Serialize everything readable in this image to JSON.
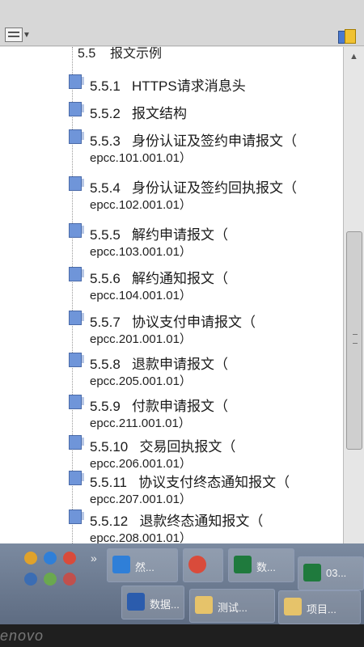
{
  "toolbar": {
    "left_icon": "bookmark-options-icon",
    "right_icon": "pdf-export-icon"
  },
  "heading": {
    "number": "5.5",
    "label": "报文示例"
  },
  "items": [
    {
      "number": "5.5.1",
      "title": "HTTPS请求消息头",
      "code": ""
    },
    {
      "number": "5.5.2",
      "title": "报文结构",
      "code": ""
    },
    {
      "number": "5.5.3",
      "title": "身份认证及签约申请报文（",
      "code": "epcc.101.001.01）"
    },
    {
      "number": "5.5.4",
      "title": "身份认证及签约回执报文（",
      "code": "epcc.102.001.01）"
    },
    {
      "number": "5.5.5",
      "title": "解约申请报文（",
      "code": "epcc.103.001.01）"
    },
    {
      "number": "5.5.6",
      "title": "解约通知报文（",
      "code": "epcc.104.001.01）"
    },
    {
      "number": "5.5.7",
      "title": "协议支付申请报文（",
      "code": "epcc.201.001.01）"
    },
    {
      "number": "5.5.8",
      "title": "退款申请报文（",
      "code": "epcc.205.001.01）"
    },
    {
      "number": "5.5.9",
      "title": "付款申请报文（",
      "code": "epcc.211.001.01）"
    },
    {
      "number": "5.5.10",
      "title": "交易回执报文（",
      "code": "epcc.206.001.01）"
    },
    {
      "number": "5.5.11",
      "title": "协议支付终态通知报文（",
      "code": "epcc.207.001.01）"
    },
    {
      "number": "5.5.12",
      "title": "退款终态通知报文（",
      "code": "epcc.208.001.01）"
    }
  ],
  "taskbar": {
    "items": [
      {
        "label": "IE",
        "glyph_color": "#2f7fd8",
        "text": "然..."
      },
      {
        "label": "Chrome",
        "glyph_color": "#d94b3b",
        "text": ""
      },
      {
        "label": "Excel",
        "glyph_color": "#1f7a3d",
        "text": "数..."
      },
      {
        "label": "Excel",
        "glyph_color": "#1f7a3d",
        "text": "03..."
      },
      {
        "label": "Word",
        "glyph_color": "#2b5cad",
        "text": "数据..."
      },
      {
        "label": "Folder",
        "glyph_color": "#e6c36a",
        "text": "测试..."
      },
      {
        "label": "Folder",
        "glyph_color": "#e6c36a",
        "text": "项目..."
      }
    ]
  },
  "brand": "enovo"
}
